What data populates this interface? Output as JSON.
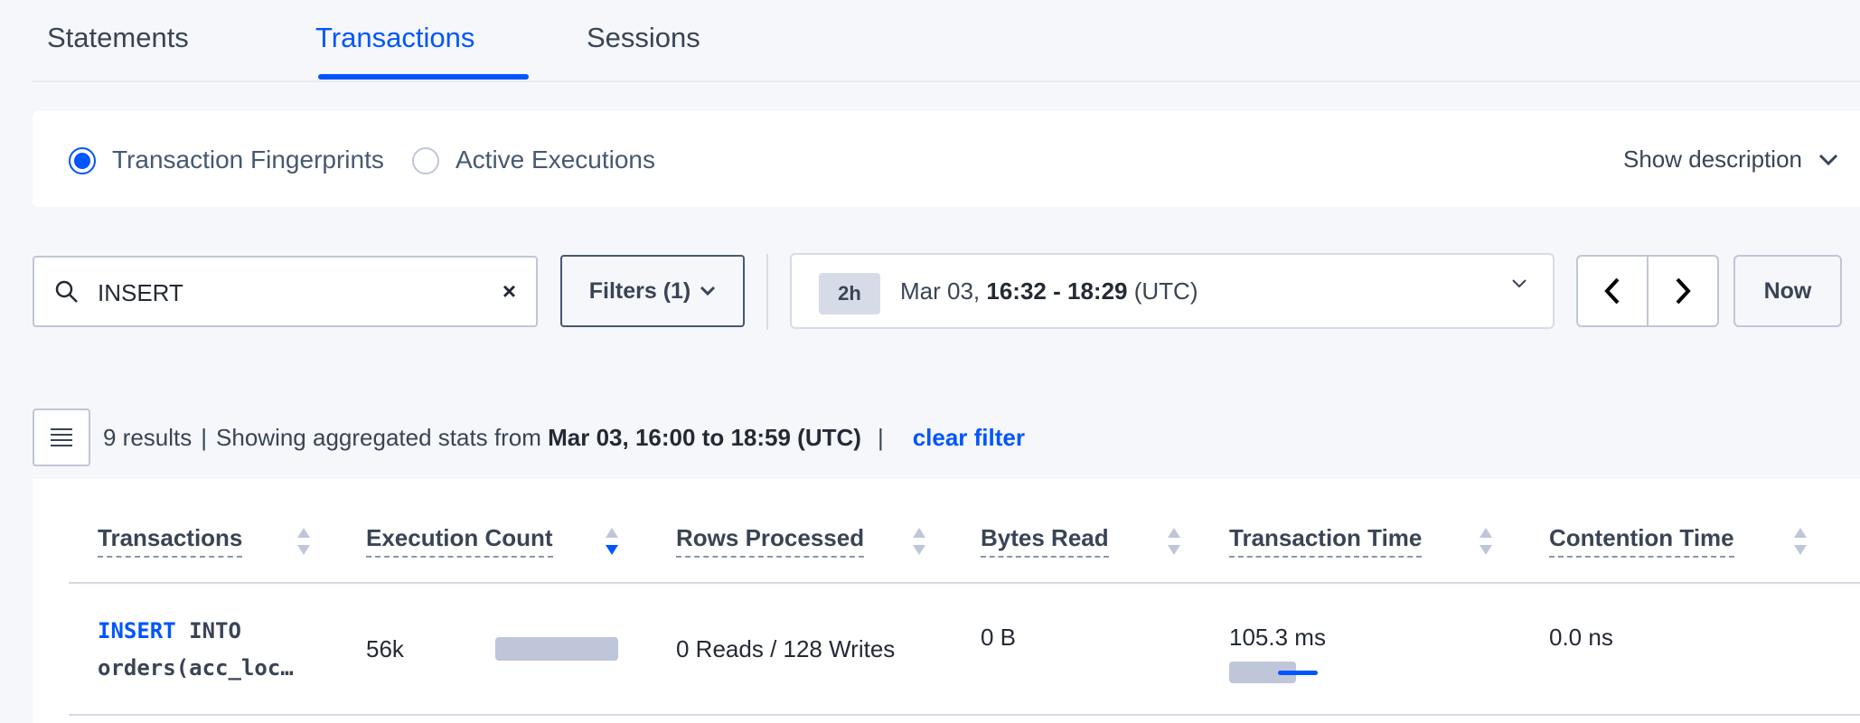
{
  "tabs": [
    "Statements",
    "Transactions",
    "Sessions"
  ],
  "view_toggle": {
    "option1": "Transaction Fingerprints",
    "option2": "Active Executions",
    "selected": "Transaction Fingerprints",
    "show_description": "Show description"
  },
  "search": {
    "value": "INSERT",
    "clear": "×"
  },
  "filters_label": "Filters (1)",
  "time_range": {
    "preset": "2h",
    "date": "Mar 03,",
    "range": "16:32 - 18:29",
    "tz": "(UTC)"
  },
  "now_label": "Now",
  "results": {
    "count": "9 results",
    "text": "Showing aggregated stats from",
    "range": "Mar 03, 16:00 to 18:59 (UTC)",
    "clear": "clear filter"
  },
  "table": {
    "columns": [
      "Transactions",
      "Execution Count",
      "Rows Processed",
      "Bytes Read",
      "Transaction Time",
      "Contention Time"
    ],
    "rows": [
      {
        "keyword": "INSERT",
        "rest": " INTO",
        "line2": "orders(acc_loc…",
        "execution_count": "56k",
        "rows_processed": "0 Reads / 128 Writes",
        "bytes_read": "0 B",
        "transaction_time": "105.3 ms",
        "contention_time": "0.0 ns"
      }
    ]
  },
  "colors": {
    "accent": "#0055ff",
    "text": "#394455",
    "border": "#c0c6d9"
  }
}
